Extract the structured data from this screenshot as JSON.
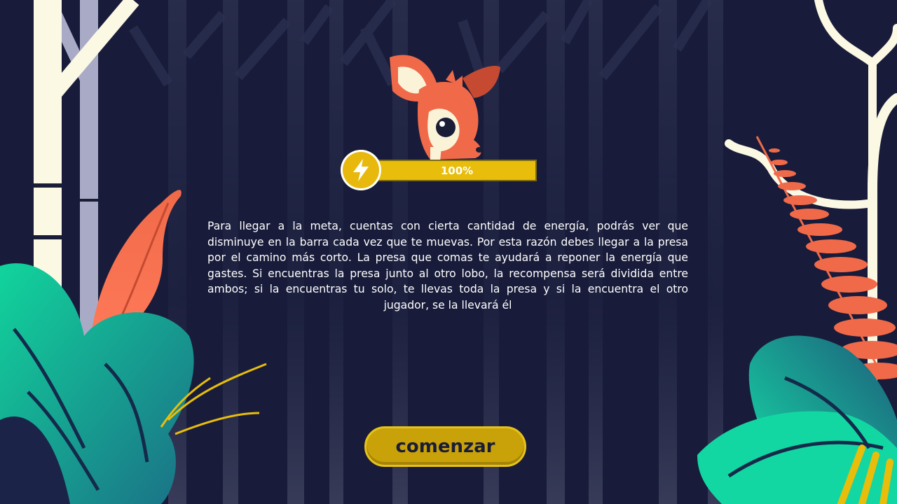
{
  "energy": {
    "label": "100%",
    "fraction": 1.0,
    "icon": "lightning-bolt-icon",
    "color": "#e8bd0b"
  },
  "instructions": {
    "text": "Para llegar a la meta, cuentas con cierta cantidad de energía, podrás ver que disminuye en la barra cada vez que te muevas. Por esta razón debes llegar a la presa por el camino más corto. La presa que comas te ayudará a reponer la energía que gastes. Si encuentras la presa junto al otro lobo, la recompensa será dividida entre ambos; si la encuentras tu solo, te llevas toda la presa y si la encuentra el otro jugador, se la llevará él"
  },
  "start_button": {
    "label": "comenzar"
  },
  "colors": {
    "background": "#181c3a",
    "accent": "#e8bd0b",
    "deer": "#f06a4a",
    "foliage": "#1fb9a0"
  }
}
